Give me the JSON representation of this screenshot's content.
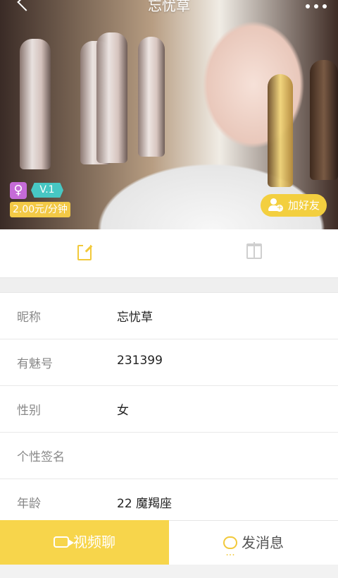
{
  "header": {
    "title": "忘忧草"
  },
  "profile": {
    "gender_symbol": "♀",
    "vip_label": "V.1",
    "price": "2.00元/分钟",
    "add_friend_label": "加好友"
  },
  "tabs": [
    {
      "icon": "edit-icon"
    },
    {
      "icon": "gift-icon"
    }
  ],
  "info": {
    "rows": [
      {
        "label": "昵称",
        "value": "忘忧草"
      },
      {
        "label": "有魅号",
        "value": "231399"
      },
      {
        "label": "性别",
        "value": "女"
      },
      {
        "label": "个性签名",
        "value": ""
      },
      {
        "label": "年龄",
        "value": "22 魔羯座"
      }
    ]
  },
  "actions": {
    "video_chat": "视频聊",
    "send_message": "发消息"
  },
  "colors": {
    "accent_yellow": "#F7D54B",
    "vip_teal": "#47C7C3",
    "gender_purple": "#C56BD7"
  }
}
